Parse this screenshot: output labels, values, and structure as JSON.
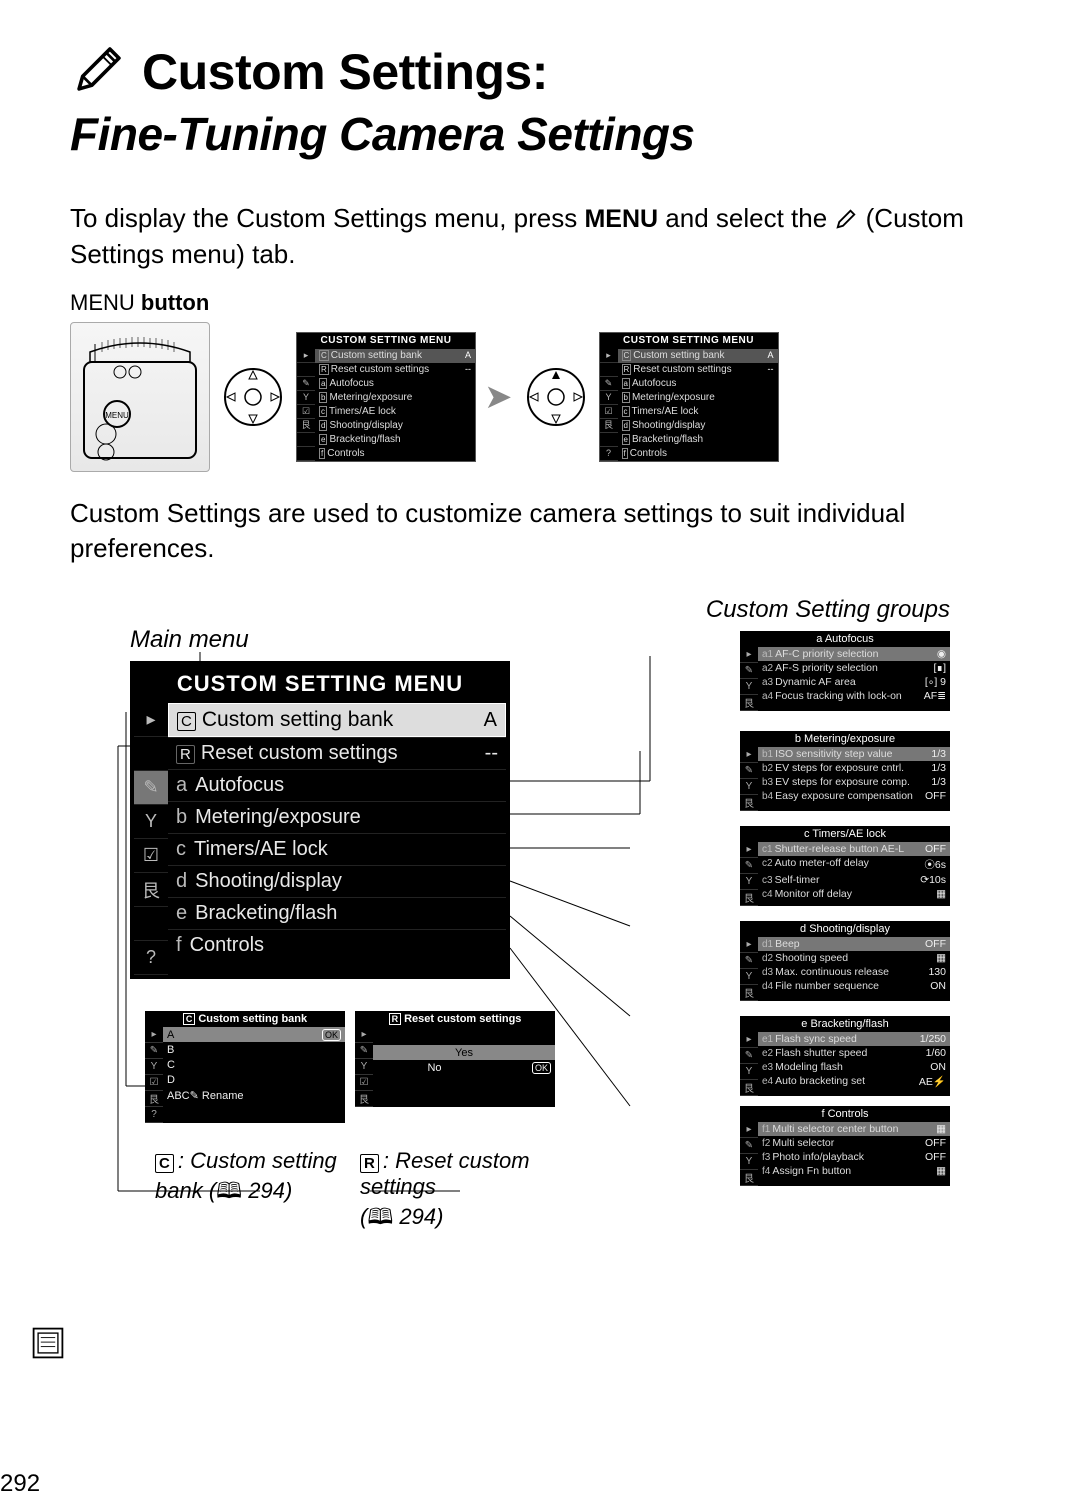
{
  "heading": {
    "title": "Custom Settings:",
    "subtitle": "Fine-Tuning Camera Settings"
  },
  "intro": {
    "part1": "To display the Custom Settings menu, press ",
    "menu_word": "MENU",
    "part2": " and select the ",
    "part3": " (Custom Settings menu) tab."
  },
  "menu_button_label": {
    "menu_word": "MENU",
    "suffix": "button"
  },
  "small_lcd": {
    "title": "CUSTOM SETTING MENU",
    "rows": [
      {
        "label": "Custom setting bank",
        "value": "A",
        "prefix": "C"
      },
      {
        "label": "Reset custom settings",
        "value": "--",
        "prefix": "R"
      },
      {
        "label": "Autofocus",
        "value": "",
        "prefix": "a"
      },
      {
        "label": "Metering/exposure",
        "value": "",
        "prefix": "b"
      },
      {
        "label": "Timers/AE lock",
        "value": "",
        "prefix": "c"
      },
      {
        "label": "Shooting/display",
        "value": "",
        "prefix": "d"
      },
      {
        "label": "Bracketing/flash",
        "value": "",
        "prefix": "e"
      },
      {
        "label": "Controls",
        "value": "",
        "prefix": "f"
      }
    ]
  },
  "body2": "Custom Settings are used to customize camera settings to suit individual preferences.",
  "labels": {
    "main_menu": "Main menu",
    "custom_setting_groups": "Custom Setting groups"
  },
  "big_lcd": {
    "title": "CUSTOM SETTING MENU",
    "rows": [
      {
        "prefix_badge": "C",
        "label": "Custom setting bank",
        "suffix": "A",
        "highlight": true
      },
      {
        "prefix_badge": "R",
        "label": "Reset custom settings",
        "suffix": "--"
      },
      {
        "prefix": "a",
        "label": "Autofocus"
      },
      {
        "prefix": "b",
        "label": "Metering/exposure"
      },
      {
        "prefix": "c",
        "label": "Timers/AE lock"
      },
      {
        "prefix": "d",
        "label": "Shooting/display"
      },
      {
        "prefix": "e",
        "label": "Bracketing/flash"
      },
      {
        "prefix": "f",
        "label": "Controls"
      }
    ]
  },
  "bank_lcd": {
    "title": "Custom setting bank",
    "rows": [
      {
        "label": "A",
        "value": "OK",
        "hi": true
      },
      {
        "label": "B",
        "value": ""
      },
      {
        "label": "C",
        "value": ""
      },
      {
        "label": "D",
        "value": ""
      },
      {
        "label": "ABC✎ Rename",
        "value": ""
      }
    ]
  },
  "reset_lcd": {
    "title": "Reset custom settings",
    "rows": [
      {
        "label": "Yes",
        "value": "",
        "hi": true
      },
      {
        "label": "No",
        "value": "OK"
      }
    ]
  },
  "groups": [
    {
      "title": "a Autofocus",
      "rows": [
        {
          "pre": "a1",
          "label": "AF-C priority selection",
          "val": "◉"
        },
        {
          "pre": "a2",
          "label": "AF-S priority selection",
          "val": "[∎]"
        },
        {
          "pre": "a3",
          "label": "Dynamic AF area",
          "val": "[∘] 9"
        },
        {
          "pre": "a4",
          "label": "Focus tracking with lock-on",
          "val": "AF≣"
        }
      ]
    },
    {
      "title": "b Metering/exposure",
      "rows": [
        {
          "pre": "b1",
          "label": "ISO sensitivity step value",
          "val": "1/3"
        },
        {
          "pre": "b2",
          "label": "EV steps for exposure cntrl.",
          "val": "1/3"
        },
        {
          "pre": "b3",
          "label": "EV steps for exposure comp.",
          "val": "1/3"
        },
        {
          "pre": "b4",
          "label": "Easy exposure compensation",
          "val": "OFF"
        }
      ]
    },
    {
      "title": "c Timers/AE lock",
      "rows": [
        {
          "pre": "c1",
          "label": "Shutter-release button AE-L",
          "val": "OFF"
        },
        {
          "pre": "c2",
          "label": "Auto meter-off delay",
          "val": "⦿6s"
        },
        {
          "pre": "c3",
          "label": "Self-timer",
          "val": "⟳10s"
        },
        {
          "pre": "c4",
          "label": "Monitor off delay",
          "val": "▦"
        }
      ]
    },
    {
      "title": "d Shooting/display",
      "rows": [
        {
          "pre": "d1",
          "label": "Beep",
          "val": "OFF"
        },
        {
          "pre": "d2",
          "label": "Shooting speed",
          "val": "▦"
        },
        {
          "pre": "d3",
          "label": "Max. continuous release",
          "val": "130"
        },
        {
          "pre": "d4",
          "label": "File number sequence",
          "val": "ON"
        }
      ]
    },
    {
      "title": "e Bracketing/flash",
      "rows": [
        {
          "pre": "e1",
          "label": "Flash sync speed",
          "val": "1/250"
        },
        {
          "pre": "e2",
          "label": "Flash shutter speed",
          "val": "1/60"
        },
        {
          "pre": "e3",
          "label": "Modeling flash",
          "val": "ON"
        },
        {
          "pre": "e4",
          "label": "Auto bracketing set",
          "val": "AE⚡"
        }
      ]
    },
    {
      "title": "f Controls",
      "rows": [
        {
          "pre": "f1",
          "label": "Multi selector center button",
          "val": "▦"
        },
        {
          "pre": "f2",
          "label": "Multi selector",
          "val": "OFF"
        },
        {
          "pre": "f3",
          "label": "Photo info/playback",
          "val": "OFF"
        },
        {
          "pre": "f4",
          "label": "Assign Fn button",
          "val": "▦"
        }
      ]
    }
  ],
  "captions": {
    "bank": {
      "badge": "C",
      "text1": ": Custom setting",
      "text2": "bank (",
      "page": "294",
      "text3": ")"
    },
    "reset": {
      "badge": "R",
      "text1": ": Reset custom",
      "text2": "settings",
      "text3": "(",
      "page": "294",
      "text4": ")"
    }
  },
  "page_number": "292"
}
